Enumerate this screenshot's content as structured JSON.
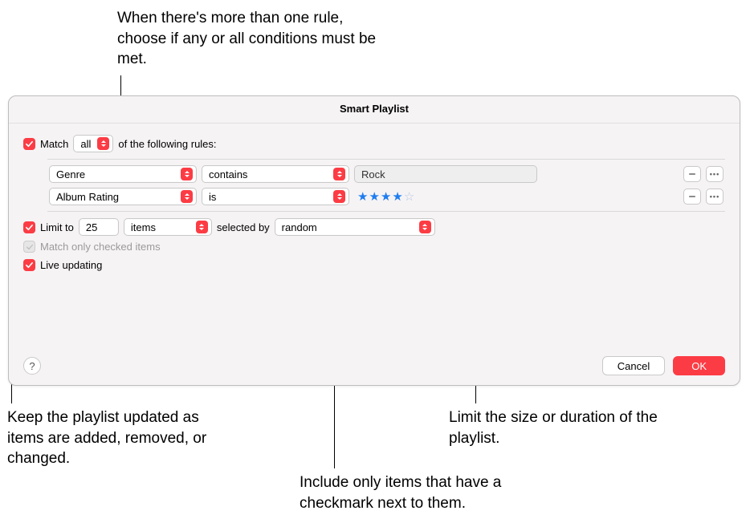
{
  "annotations": {
    "match_mode": "When there's more than one rule, choose if any or all conditions must be met.",
    "live_updating": "Keep the playlist updated as items are added, removed, or changed.",
    "checked_items": "Include only items that have a checkmark next to them.",
    "limit": "Limit the size or duration of the playlist."
  },
  "window": {
    "title": "Smart Playlist"
  },
  "match": {
    "checked": true,
    "prefix": "Match",
    "mode": "all",
    "suffix": "of the following rules:"
  },
  "rules": [
    {
      "field": "Genre",
      "op": "contains",
      "value": "Rock",
      "value_type": "text"
    },
    {
      "field": "Album Rating",
      "op": "is",
      "value": 4,
      "value_type": "stars"
    }
  ],
  "limit": {
    "checked": true,
    "prefix": "Limit to",
    "count": "25",
    "unit": "items",
    "selected_by_label": "selected by",
    "selected_by": "random"
  },
  "checked_items": {
    "label": "Match only checked items",
    "enabled": false,
    "checked": true
  },
  "live_updating": {
    "label": "Live updating",
    "checked": true
  },
  "footer": {
    "help": "?",
    "cancel": "Cancel",
    "ok": "OK"
  }
}
